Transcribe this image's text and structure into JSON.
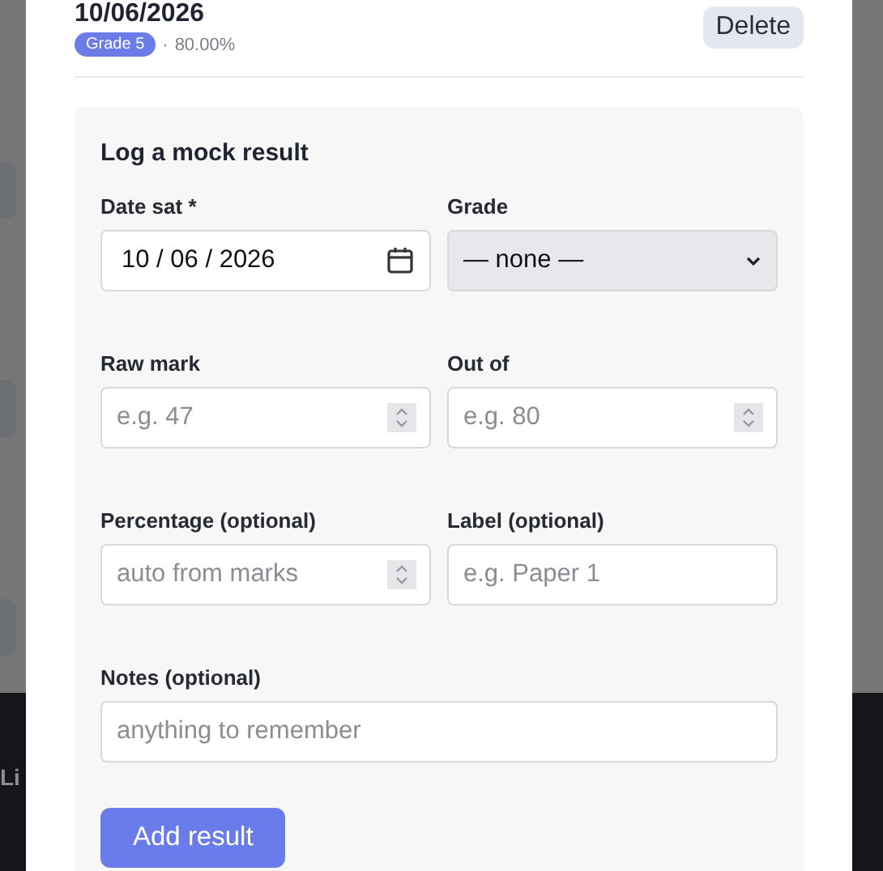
{
  "background": {
    "footer_texts": [
      "Li"
    ]
  },
  "entry": {
    "date": "10/06/2026",
    "grade_badge": "Grade 5",
    "separator": "·",
    "percentage": "80.00%",
    "delete_button": "Delete"
  },
  "form": {
    "title": "Log a mock result",
    "fields": [
      {
        "kind": "date",
        "label": "Date sat *",
        "value": "10 / 06 / 2026"
      },
      {
        "kind": "select",
        "label": "Grade",
        "value": "— none —"
      },
      {
        "kind": "number",
        "label": "Raw mark",
        "placeholder": "e.g. 47"
      },
      {
        "kind": "number",
        "label": "Out of",
        "placeholder": "e.g. 80"
      },
      {
        "kind": "number",
        "label": "Percentage (optional)",
        "placeholder": "auto from marks"
      },
      {
        "kind": "text",
        "label": "Label (optional)",
        "placeholder": "e.g. Paper 1"
      },
      {
        "kind": "text",
        "label": "Notes (optional)",
        "placeholder": "anything to remember"
      }
    ],
    "submit_button": "Add result"
  }
}
